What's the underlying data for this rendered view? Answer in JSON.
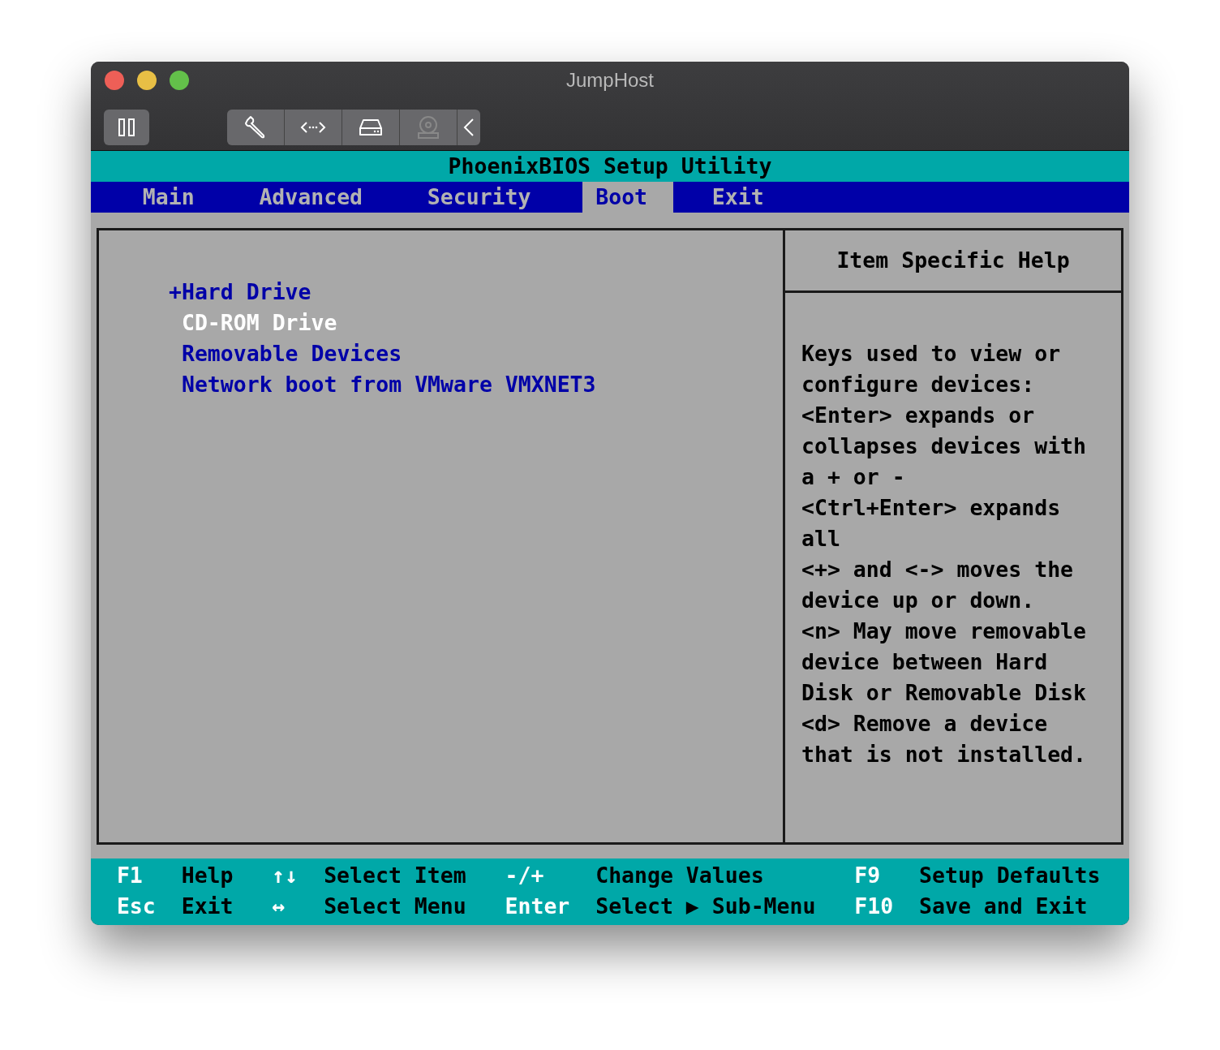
{
  "window": {
    "title": "JumpHost"
  },
  "bios": {
    "title": "PhoenixBIOS Setup Utility",
    "tabs": [
      {
        "label": "Main",
        "selected": false
      },
      {
        "label": "Advanced",
        "selected": false
      },
      {
        "label": "Security",
        "selected": false
      },
      {
        "label": "Boot",
        "selected": true
      },
      {
        "label": "Exit",
        "selected": false
      }
    ],
    "boot_items": [
      {
        "marker": "+",
        "label": "Hard Drive",
        "selected": false
      },
      {
        "label": "CD-ROM Drive",
        "selected": true
      },
      {
        "label": "Removable Devices",
        "selected": false
      },
      {
        "label": "Network boot from VMware VMXNET3",
        "selected": false
      }
    ],
    "help": {
      "title": "Item Specific Help",
      "lines": [
        "Keys used to view or",
        "configure devices:",
        "<Enter> expands or",
        "collapses devices with",
        "a + or -",
        "<Ctrl+Enter> expands",
        "all",
        "<+> and <-> moves the",
        "device up or down.",
        "<n> May move removable",
        "device between Hard",
        "Disk or Removable Disk",
        "<d> Remove a device",
        "that is not installed."
      ]
    },
    "footer": [
      [
        {
          "key": "F1",
          "action": "Help"
        },
        {
          "key": "↑↓",
          "action": "Select Item"
        },
        {
          "key": "-/+",
          "action": "Change Values"
        },
        {
          "key": "F9",
          "action": "Setup Defaults"
        }
      ],
      [
        {
          "key": "Esc",
          "action": "Exit"
        },
        {
          "key": "↔",
          "action": "Select Menu"
        },
        {
          "key": "Enter",
          "action": "Select ▶ Sub-Menu"
        },
        {
          "key": "F10",
          "action": "Save and Exit"
        }
      ]
    ]
  }
}
